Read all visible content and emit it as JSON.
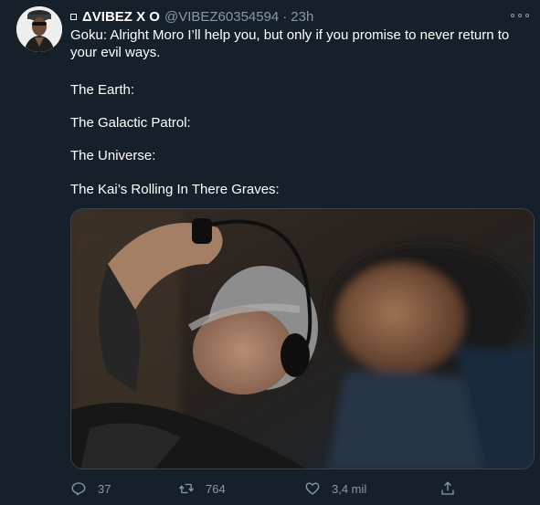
{
  "tweet": {
    "author_name": "ΔVIBEZ X O",
    "author_handle": "@VIBEZ60354594",
    "separator": "·",
    "time": "23h",
    "text_line1": "Goku: Alright Moro I’ll help you, but only if you promise to never return to your evil ways.",
    "lines": [
      "The Earth:",
      "The Galactic Patrol:",
      "The Universe:",
      "The Kai’s Rolling In There Graves:"
    ]
  },
  "actions": {
    "reply_count": "37",
    "retweet_count": "764",
    "like_count": "3,4 mil"
  },
  "icons": {
    "more": "more-horizontal-icon",
    "reply": "reply-icon",
    "retweet": "retweet-icon",
    "like": "heart-icon",
    "share": "share-icon"
  },
  "colors": {
    "background": "#15202b",
    "secondary_text": "#8899a6",
    "border": "#38444d"
  }
}
